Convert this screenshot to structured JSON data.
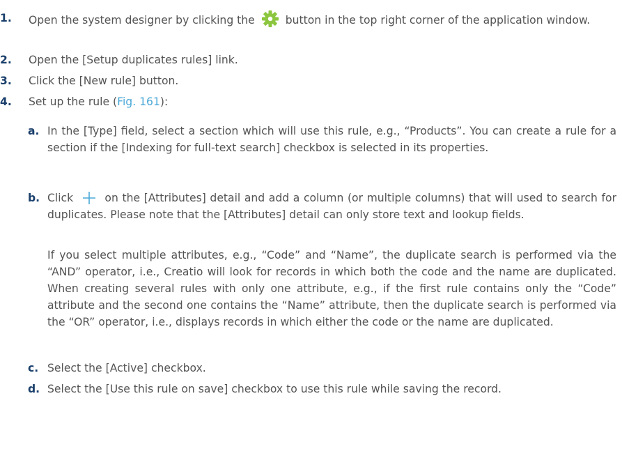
{
  "steps": [
    {
      "num": "1.",
      "before": "Open the system designer by clicking the",
      "icon": "gear-icon",
      "after": "button in the top right corner of the application window."
    },
    {
      "num": "2.",
      "text": "Open the [Setup duplicates rules] link."
    },
    {
      "num": "3.",
      "text": "Click the [New rule] button."
    },
    {
      "num": "4.",
      "before": "Set up the rule (",
      "link": "Fig. 161",
      "after": "):"
    }
  ],
  "substeps": [
    {
      "num": "a.",
      "text": "In the [Type] field, select a section which will use this rule, e.g., “Products”. You can create a rule for a section if the [Indexing for full-text search] checkbox is selected in its properties."
    },
    {
      "num": "b.",
      "before": "Click",
      "icon": "plus-icon",
      "after": "on the [Attributes] detail and add a column (or multiple columns) that will used to search for duplicates. Please note that the [Attributes] detail can only store text and lookup fields.",
      "note": "If you select multiple attributes, e.g., “Code” and “Name”, the duplicate search is performed via the “AND” operator, i.e., Creatio will look for records in which both the code and the name are duplicated. When creating several rules with only one attribute, e.g., if the first rule contains only the “Code” attribute and the second one contains the “Name” attribute, then the duplicate search is performed via the “OR” operator, i.e., displays records in which either the code or the name are duplicated."
    },
    {
      "num": "c.",
      "text": "Select the [Active] checkbox."
    },
    {
      "num": "d.",
      "text": "Select the [Use this rule on save] checkbox to use this rule while saving the record."
    }
  ],
  "colors": {
    "number": "#1a3f6b",
    "text": "#545454",
    "link": "#4aa8d8",
    "gear": "#8cc63f"
  }
}
